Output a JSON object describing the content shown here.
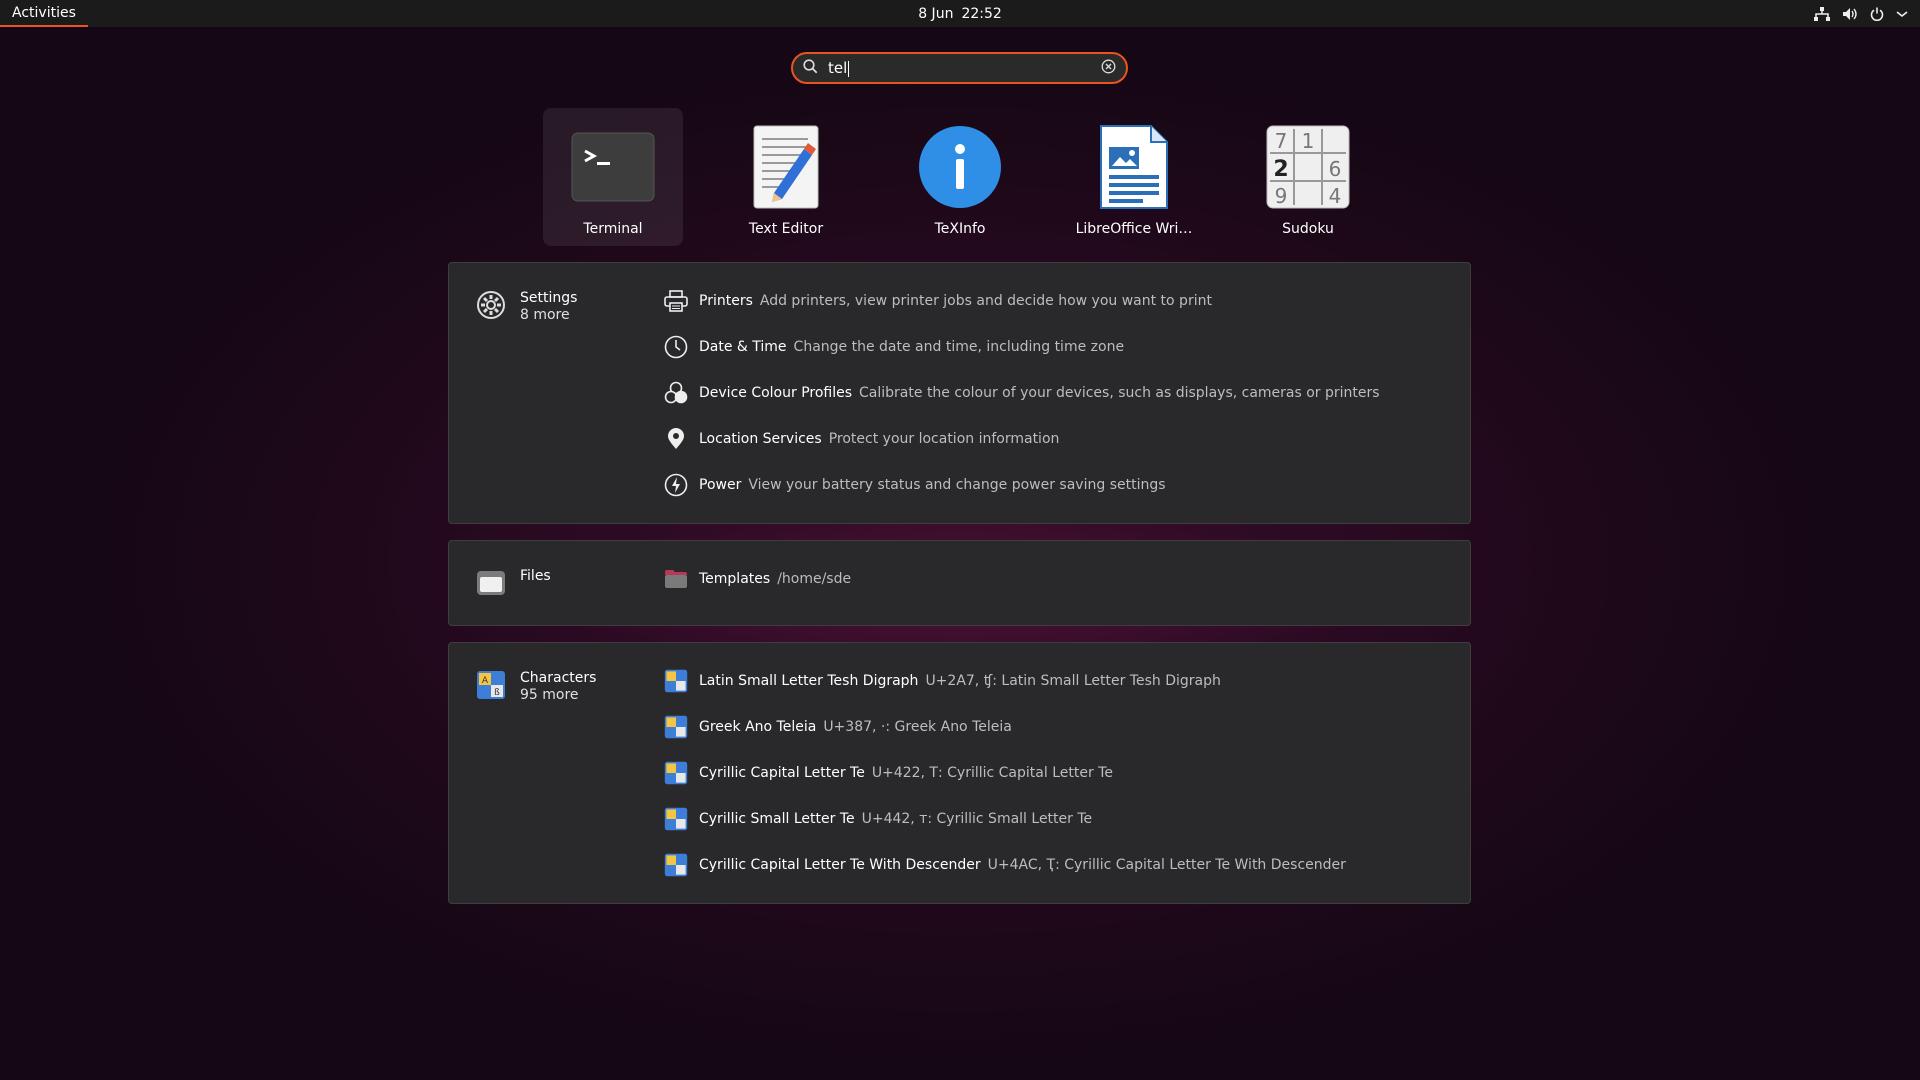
{
  "topbar": {
    "activities": "Activities",
    "date": "8 Jun",
    "time": "22:52",
    "tray_icons": [
      "network-icon",
      "volume-icon",
      "power-icon",
      "chevron-down-icon"
    ]
  },
  "search": {
    "value": "tel",
    "accent": "#e95420"
  },
  "apps": [
    {
      "label": "Terminal",
      "icon": "terminal-icon"
    },
    {
      "label": "Text Editor",
      "icon": "text-editor-icon"
    },
    {
      "label": "TeXInfo",
      "icon": "info-icon"
    },
    {
      "label": "LibreOffice Wri…",
      "icon": "libreoffice-writer-icon"
    },
    {
      "label": "Sudoku",
      "icon": "sudoku-icon"
    }
  ],
  "settings": {
    "name": "Settings",
    "more": "8 more",
    "icon": "settings-gear-icon",
    "results": [
      {
        "title": "Printers",
        "desc": "Add printers, view printer jobs and decide how you want to print",
        "icon": "printer-icon"
      },
      {
        "title": "Date & Time",
        "desc": "Change the date and time, including time zone",
        "icon": "clock-icon"
      },
      {
        "title": "Device Colour Profiles",
        "desc": "Calibrate the colour of your devices, such as displays, cameras or printers",
        "icon": "color-profiles-icon"
      },
      {
        "title": "Location Services",
        "desc": "Protect your location information",
        "icon": "location-pin-icon"
      },
      {
        "title": "Power",
        "desc": "View your battery status and change power saving settings",
        "icon": "power-bolt-icon"
      }
    ]
  },
  "files": {
    "name": "Files",
    "icon": "files-folder-icon",
    "results": [
      {
        "title": "Templates",
        "desc": "/home/sde",
        "icon": "folder-icon"
      }
    ]
  },
  "characters": {
    "name": "Characters",
    "more": "95 more",
    "icon": "characters-icon",
    "results": [
      {
        "title": "Latin Small Letter Tesh Digraph",
        "desc": "U+2A7, ʧ: Latin Small Letter Tesh Digraph",
        "icon": "character-icon"
      },
      {
        "title": "Greek Ano Teleia",
        "desc": "U+387, ·: Greek Ano Teleia",
        "icon": "character-icon"
      },
      {
        "title": "Cyrillic Capital Letter Te",
        "desc": "U+422, Т: Cyrillic Capital Letter Te",
        "icon": "character-icon"
      },
      {
        "title": "Cyrillic Small Letter Te",
        "desc": "U+442, т: Cyrillic Small Letter Te",
        "icon": "character-icon"
      },
      {
        "title": "Cyrillic Capital Letter Te With Descender",
        "desc": "U+4AC, Ҭ: Cyrillic Capital Letter Te With Descender",
        "icon": "character-icon"
      }
    ]
  }
}
